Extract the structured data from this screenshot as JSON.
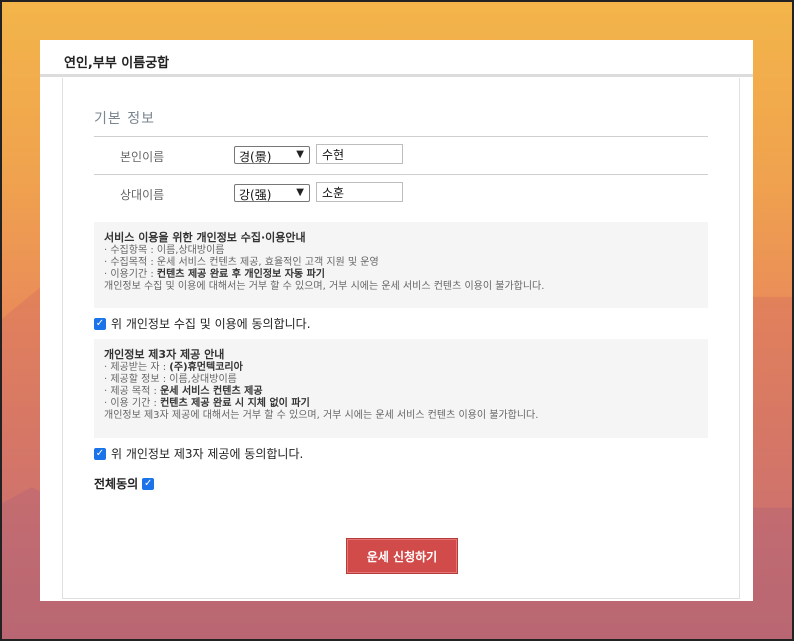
{
  "page": {
    "title": "연인,부부 이름궁합"
  },
  "section": {
    "title": "기본 정보"
  },
  "form": {
    "self": {
      "label": "본인이름",
      "surname": "경(景)",
      "name": "수현"
    },
    "partner": {
      "label": "상대이름",
      "surname": "강(强)",
      "name": "소훈"
    }
  },
  "privacy": {
    "title": "서비스 이용을 위한 개인정보 수집·이용안내",
    "item1": "· 수집항목 : 이름,상대방이름",
    "item2": "· 수집목적 : 운세 서비스 컨텐츠 제공, 효율적인 고객 지원 및 운영",
    "item3_prefix": "· 이용기간 : ",
    "item3_value": "컨텐츠 제공 완료 후 개인정보 자동 파기",
    "note": "개인정보 수집 및 이용에 대해서는 거부 할 수 있으며, 거부 시에는 운세 서비스 컨텐츠 이용이 불가합니다.",
    "agree_label": "위 개인정보 수집 및 이용에 동의합니다."
  },
  "third_party": {
    "title": "개인정보 제3자 제공 안내",
    "item1_prefix": "· 제공받는 자 : ",
    "item1_value": "(주)휴먼텍코리아",
    "item2": "· 제공할 정보 : 이름,상대방이름",
    "item3_prefix": "· 제공 목적 : ",
    "item3_value": "운세 서비스 컨텐츠 제공",
    "item4_prefix": "· 이용 기간 : ",
    "item4_value": "컨텐츠 제공 완료 시 지체 없이 파기",
    "note": "개인정보 제3자 제공에 대해서는 거부 할 수 있으며, 거부 시에는 운세 서비스 컨텐츠 이용이 불가합니다.",
    "agree_label": "위 개인정보 제3자 제공에 동의합니다."
  },
  "all_agree": {
    "label": "전체동의"
  },
  "submit": {
    "label": "운세 신청하기"
  },
  "colors": {
    "accent": "#d24b4b",
    "checkbox": "#1a73e8"
  }
}
